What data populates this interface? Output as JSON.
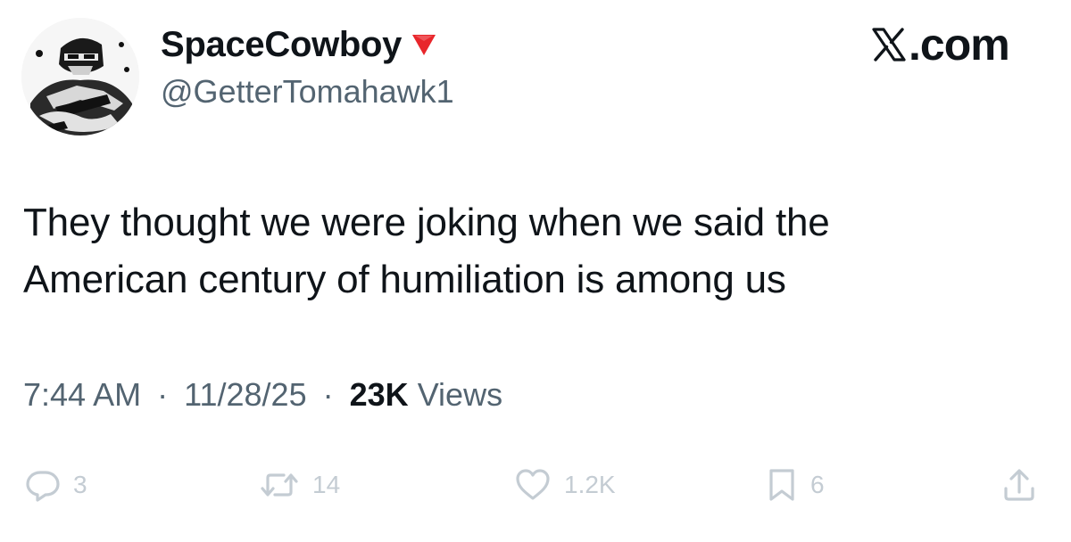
{
  "author": {
    "display_name": "SpaceCowboy",
    "handle": "@GetterTomahawk1"
  },
  "brand": {
    "logo_text": ".com",
    "logo_icon": "x-logo-icon"
  },
  "tweet": {
    "text_lines": [
      "They thought we were joking when we said the",
      "American century of humiliation is among us"
    ]
  },
  "meta": {
    "time": "7:44 AM",
    "separator": "·",
    "date": "11/28/25",
    "views_count": "23K",
    "views_label": "Views"
  },
  "actions": {
    "replies": "3",
    "reposts": "14",
    "likes": "1.2K",
    "bookmarks": "6"
  },
  "colors": {
    "text": "#0f1419",
    "secondary": "#536471",
    "action_faded": "#c4ccd3",
    "flag_red": "#e8262b"
  }
}
